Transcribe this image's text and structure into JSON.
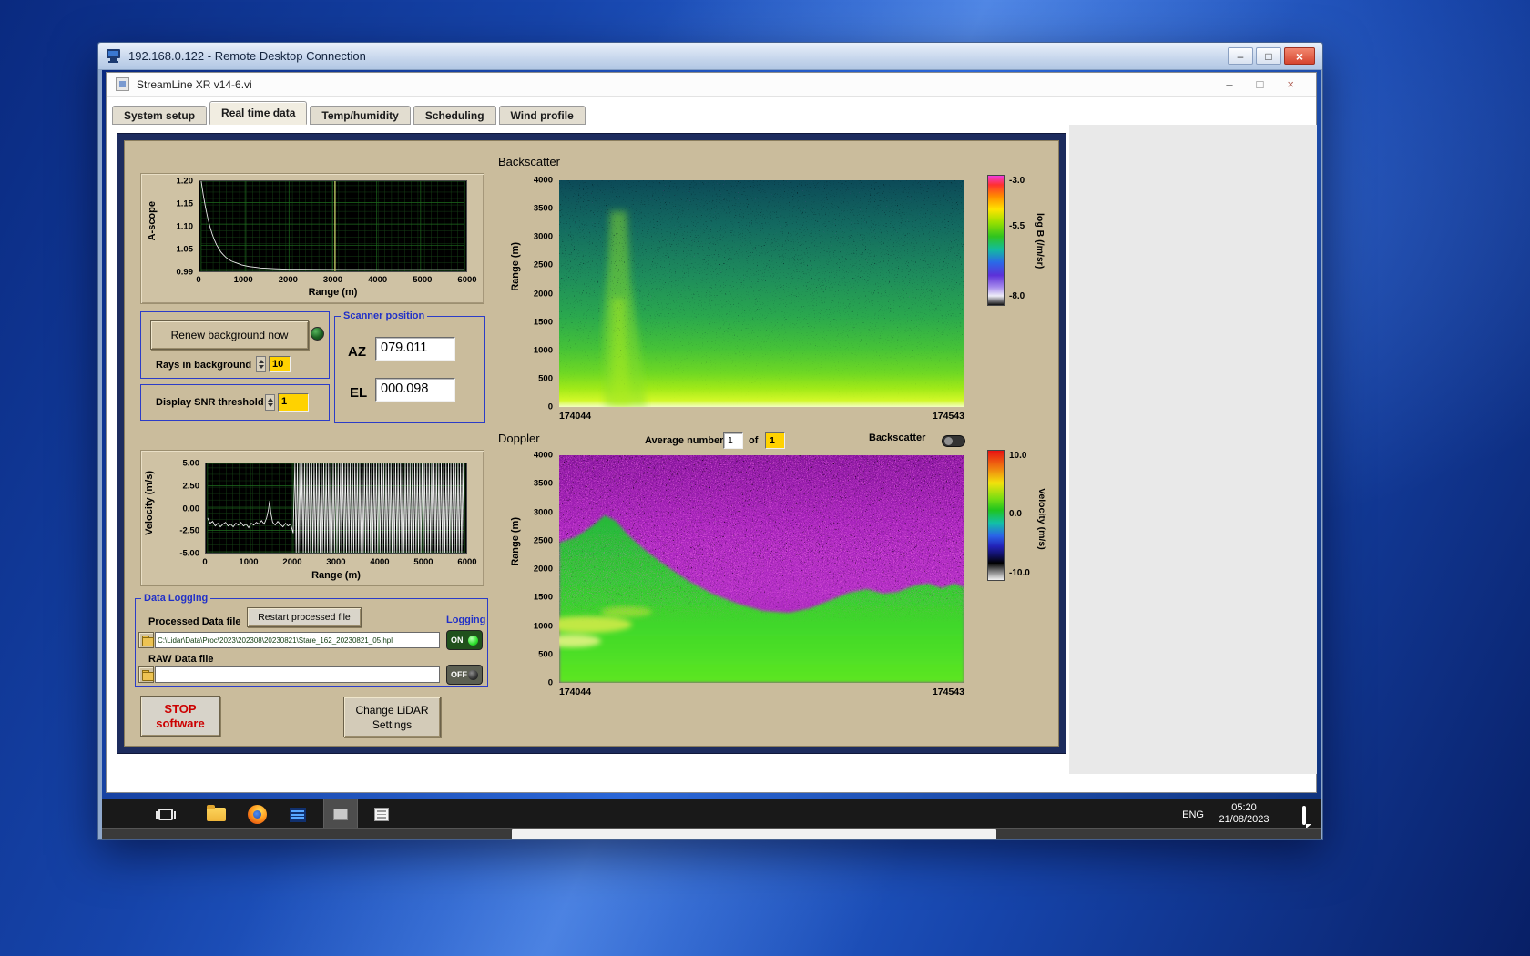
{
  "icons": {
    "minimize": "–",
    "maximize": "□",
    "close": "×"
  },
  "colors": {
    "panel_tan": "#cabc9c",
    "border_navy": "#1d2c5e",
    "field_yellow": "#ffd200",
    "led_green": "#2ee22e",
    "stop_red": "#cc0000",
    "label_blue": "#2030c8"
  },
  "rdp": {
    "title": "192.168.0.122 - Remote Desktop Connection"
  },
  "app": {
    "title": "StreamLine XR v14-6.vi",
    "tabs": [
      {
        "label": "System setup"
      },
      {
        "label": "Real time data"
      },
      {
        "label": "Temp/humidity"
      },
      {
        "label": "Scheduling"
      },
      {
        "label": "Wind profile"
      }
    ],
    "active_tab": "Real time data"
  },
  "panel": {
    "backscatter_title": "Backscatter",
    "doppler_title": "Doppler",
    "renew_button": "Renew background now",
    "rays_label": "Rays in background",
    "rays_value": "10",
    "snr_label": "Display SNR threshold",
    "snr_value": "1",
    "scanner": {
      "title": "Scanner position",
      "az_label": "AZ",
      "az_value": "079.011",
      "el_label": "EL",
      "el_value": "000.098"
    },
    "doppler_header": {
      "avg_label": "Average number",
      "avg_value": "1",
      "of_label": "of",
      "avg_total": "1",
      "toggle_label": "Backscatter"
    },
    "logging": {
      "title": "Data Logging",
      "processed_label": "Processed Data file",
      "restart_button": "Restart processed file",
      "logging_label": "Logging",
      "processed_path": "C:\\Lidar\\Data\\Proc\\2023\\202308\\20230821\\Stare_162_20230821_05.hpl",
      "raw_label": "RAW Data file",
      "raw_path": "",
      "on_label": "ON",
      "off_label": "OFF"
    },
    "stop_button": {
      "line1": "STOP",
      "line2": "software"
    },
    "settings_button": {
      "line1": "Change LiDAR",
      "line2": "Settings"
    }
  },
  "taskbar": {
    "language": "ENG",
    "time": "05:20",
    "date": "21/08/2023"
  },
  "chart_data": [
    {
      "id": "ascope",
      "type": "line",
      "ylabel": "A-scope",
      "xlabel": "Range (m)",
      "xlim": [
        0,
        6000
      ],
      "ylim": [
        0.99,
        1.2
      ],
      "x_ticks": [
        "0",
        "1000",
        "2000",
        "3000",
        "4000",
        "5000",
        "6000"
      ],
      "y_ticks": [
        "1.20",
        "1.15",
        "1.10",
        "1.05",
        "0.99"
      ],
      "cursor_x": 3050,
      "points": [
        [
          0,
          1.2
        ],
        [
          50,
          1.166
        ],
        [
          100,
          1.138
        ],
        [
          150,
          1.114
        ],
        [
          200,
          1.094
        ],
        [
          250,
          1.077
        ],
        [
          300,
          1.063
        ],
        [
          350,
          1.052
        ],
        [
          400,
          1.043
        ],
        [
          450,
          1.035
        ],
        [
          500,
          1.029
        ],
        [
          560,
          1.023
        ],
        [
          620,
          1.018
        ],
        [
          690,
          1.014
        ],
        [
          760,
          1.011
        ],
        [
          840,
          1.008
        ],
        [
          920,
          1.005
        ],
        [
          1000,
          1.003
        ],
        [
          1100,
          1.001
        ],
        [
          1200,
          1.0
        ],
        [
          1350,
          0.998
        ],
        [
          1500,
          0.997
        ],
        [
          1700,
          0.996
        ],
        [
          2000,
          0.995
        ],
        [
          2300,
          0.9948
        ],
        [
          2600,
          0.9945
        ],
        [
          3000,
          0.9943
        ],
        [
          3400,
          0.9942
        ],
        [
          3800,
          0.9941
        ],
        [
          4200,
          0.994
        ],
        [
          4600,
          0.994
        ],
        [
          5000,
          0.994
        ],
        [
          5400,
          0.994
        ],
        [
          5800,
          0.994
        ],
        [
          6000,
          0.994
        ]
      ]
    },
    {
      "id": "velocity",
      "type": "line",
      "ylabel": "Velocity (m/s)",
      "xlabel": "Range (m)",
      "xlim": [
        0,
        6000
      ],
      "ylim": [
        -5,
        5
      ],
      "x_ticks": [
        "0",
        "1000",
        "2000",
        "3000",
        "4000",
        "5000",
        "6000"
      ],
      "y_ticks": [
        "5.00",
        "2.50",
        "0.00",
        "-2.50",
        "-5.00"
      ],
      "points": [
        [
          0,
          -1.1
        ],
        [
          60,
          -1.7
        ],
        [
          120,
          -1.5
        ],
        [
          180,
          -2.0
        ],
        [
          240,
          -1.7
        ],
        [
          300,
          -2.1
        ],
        [
          360,
          -1.8
        ],
        [
          420,
          -1.6
        ],
        [
          480,
          -2.0
        ],
        [
          540,
          -1.8
        ],
        [
          600,
          -2.1
        ],
        [
          660,
          -1.7
        ],
        [
          720,
          -1.9
        ],
        [
          780,
          -1.6
        ],
        [
          840,
          -2.0
        ],
        [
          900,
          -1.8
        ],
        [
          960,
          -2.2
        ],
        [
          1020,
          -1.7
        ],
        [
          1080,
          -1.9
        ],
        [
          1140,
          -1.6
        ],
        [
          1200,
          -1.8
        ],
        [
          1260,
          -1.4
        ],
        [
          1320,
          -1.8
        ],
        [
          1380,
          -1.1
        ],
        [
          1420,
          -0.2
        ],
        [
          1450,
          0.8
        ],
        [
          1480,
          -0.6
        ],
        [
          1520,
          -1.6
        ],
        [
          1580,
          -1.9
        ],
        [
          1640,
          -1.5
        ],
        [
          1700,
          -1.8
        ],
        [
          1760,
          -2.1
        ],
        [
          1820,
          -1.7
        ],
        [
          1880,
          -2.0
        ],
        [
          1940,
          -1.8
        ],
        [
          2000,
          -2.8
        ]
      ],
      "saturated": {
        "from": 2040,
        "to": 6000,
        "step": 56,
        "high": 5,
        "low": -5
      }
    },
    {
      "id": "backscatter",
      "type": "heatmap",
      "title": "Backscatter",
      "ylabel": "Range (m)",
      "ylim_m": [
        0,
        4000
      ],
      "y_ticks": [
        "4000",
        "3500",
        "3000",
        "2500",
        "2000",
        "1500",
        "1000",
        "500",
        "0"
      ],
      "x_start": "174044",
      "x_end": "174543",
      "colorbar": {
        "label": "log B (/m/sr)",
        "ticks": [
          "-3.0",
          "-5.5",
          "-8.0"
        ]
      },
      "summary": "Strong backscatter below ~500 m, speckle noise increasing aloft, plume near record start up to ~2500 m"
    },
    {
      "id": "doppler",
      "type": "heatmap",
      "title": "Doppler",
      "ylabel": "Range (m)",
      "ylim_m": [
        0,
        4000
      ],
      "y_ticks": [
        "4000",
        "3500",
        "3000",
        "2500",
        "2000",
        "1500",
        "1000",
        "500",
        "0"
      ],
      "x_start": "174044",
      "x_end": "174543",
      "colorbar": {
        "label": "Velocity (m/s)",
        "ticks": [
          "10.0",
          "0.0",
          "-10.0"
        ]
      },
      "summary": "Coherent near-zero velocity (green) below ~1000-2000 m, aliased magenta noise above"
    }
  ]
}
